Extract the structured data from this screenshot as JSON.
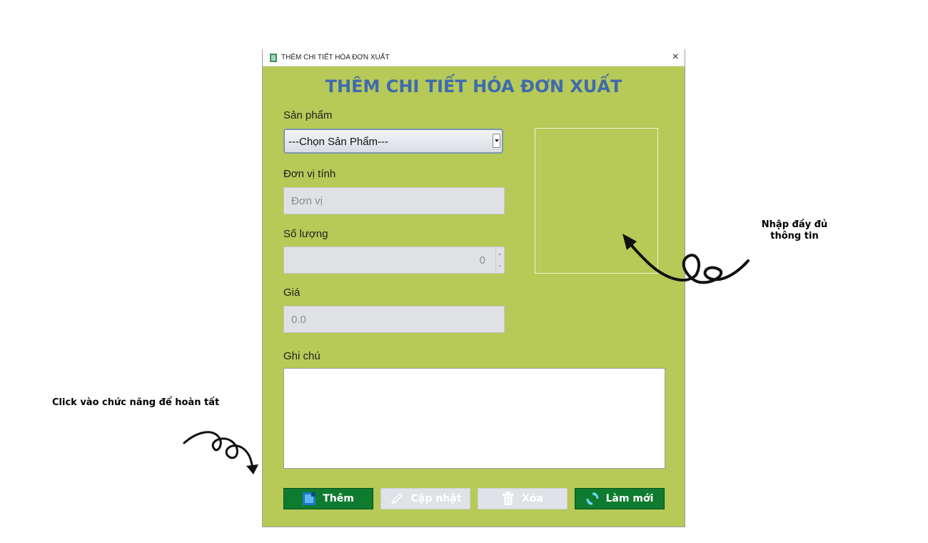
{
  "window": {
    "title": "THÊM CHI TIẾT HÓA ĐƠN XUẤT",
    "close_glyph": "×",
    "app_icon": "app-icon"
  },
  "form": {
    "heading": "THÊM CHI TIẾT HÓA ĐƠN XUẤT",
    "product": {
      "label": "Sản phẩm",
      "selected": "---Chọn Sản Phẩm---"
    },
    "unit": {
      "label": "Đơn vị tính",
      "placeholder": "Đơn vị"
    },
    "quantity": {
      "label": "Số lượng",
      "value": "0"
    },
    "price": {
      "label": "Giá",
      "value": "0.0"
    },
    "note": {
      "label": "Ghi chú",
      "value": ""
    }
  },
  "buttons": {
    "add": {
      "label": "Thêm",
      "icon": "add-icon",
      "enabled": true
    },
    "update": {
      "label": "Cập nhật",
      "icon": "pencil-icon",
      "enabled": false
    },
    "delete": {
      "label": "Xóa",
      "icon": "trash-icon",
      "enabled": false
    },
    "refresh": {
      "label": "Làm mới",
      "icon": "refresh-icon",
      "enabled": true
    }
  },
  "annotations": {
    "right": [
      "Nhập đầy đủ",
      "thông tin"
    ],
    "left": "Click vào chức năng để hoàn tất"
  },
  "colors": {
    "window_bg": "#b7c957",
    "heading": "#3f6ab0",
    "button_green": "#0e7b2f",
    "button_disabled": "#dfe2e6"
  }
}
